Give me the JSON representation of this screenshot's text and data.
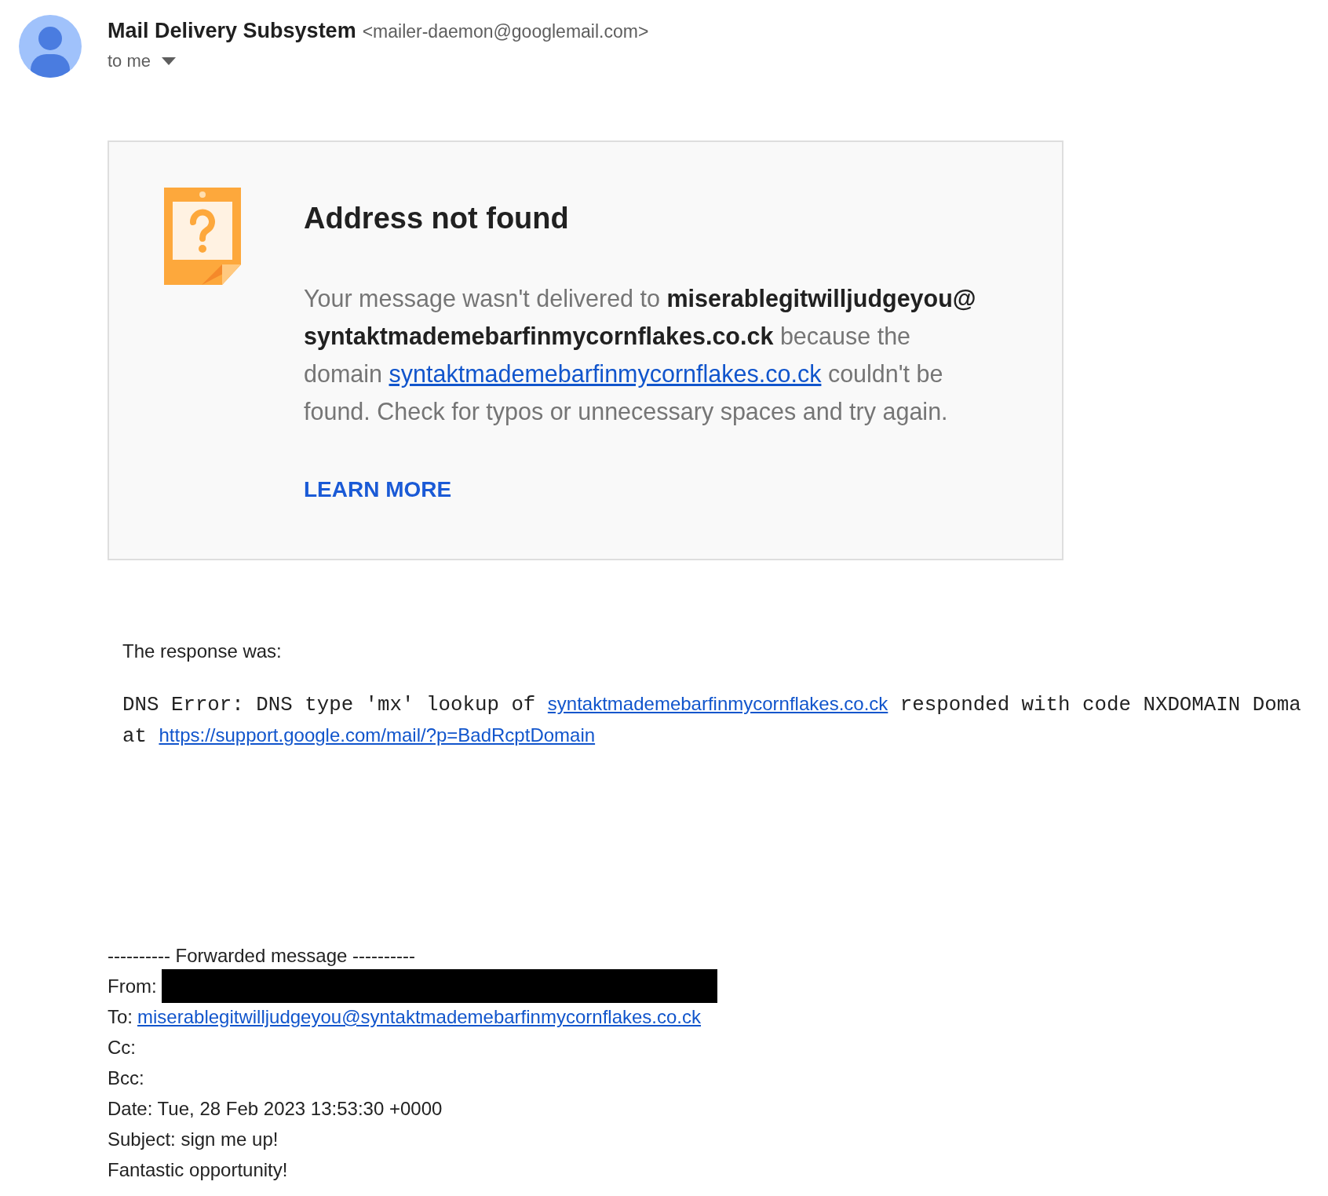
{
  "sender": {
    "name": "Mail Delivery Subsystem",
    "address": "<mailer-daemon@googlemail.com>",
    "recipients": "to me"
  },
  "bounce_card": {
    "title": "Address not found",
    "message": [
      {
        "kind": "text",
        "text": "Your message wasn't delivered to "
      },
      {
        "kind": "bold",
        "text": "miserablegitwilljudgeyou@"
      },
      {
        "kind": "bold",
        "text": "syntaktmademebarfinmycornflakes.co.ck"
      },
      {
        "kind": "text",
        "text": " because the domain "
      },
      {
        "kind": "link",
        "text": "syntaktmademebarfinmycornflakes.co.ck"
      },
      {
        "kind": "text",
        "text": " couldn't be found. Check for typos or unnecessary spaces and try again."
      }
    ],
    "action": "LEARN MORE"
  },
  "response": {
    "heading": "The response was:",
    "lines": [
      [
        {
          "kind": "text",
          "text": "DNS Error: DNS type 'mx' lookup of "
        },
        {
          "kind": "link",
          "text": "syntaktmademebarfinmycornflakes.co.ck"
        },
        {
          "kind": "text",
          "text": " responded with code NXDOMAIN Doma"
        }
      ],
      [
        {
          "kind": "text",
          "text": "at "
        },
        {
          "kind": "link",
          "text": "https://support.google.com/mail/?p=BadRcptDomain"
        }
      ]
    ]
  },
  "forwarded": [
    {
      "kind": "text",
      "text": "---------- Forwarded message ----------"
    },
    {
      "kind": "redacted",
      "label": "From:"
    },
    {
      "kind": "link",
      "label": "To:",
      "text": "miserablegitwilljudgeyou@syntaktmademebarfinmycornflakes.co.ck"
    },
    {
      "kind": "text",
      "text": "Cc:"
    },
    {
      "kind": "text",
      "text": "Bcc:"
    },
    {
      "kind": "text",
      "text": "Date: Tue, 28 Feb 2023 13:53:30 +0000"
    },
    {
      "kind": "text",
      "text": "Subject: sign me up!"
    },
    {
      "kind": "text",
      "text": "Fantastic opportunity!"
    }
  ]
}
